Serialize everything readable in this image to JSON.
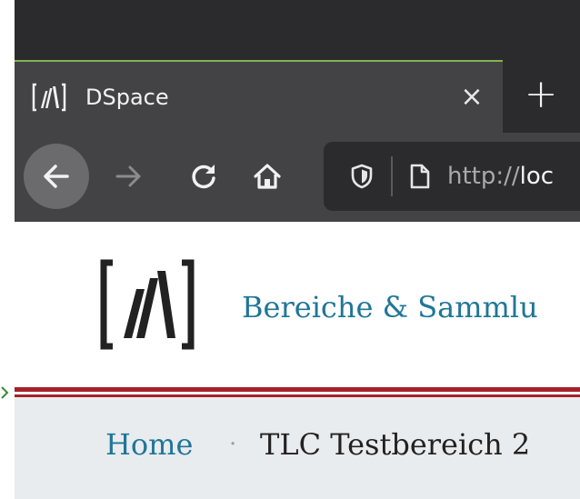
{
  "browser": {
    "tab": {
      "title": "DSpace",
      "close_glyph": "×",
      "favicon": "dspace-logo-icon"
    },
    "new_tab_glyph": "+",
    "nav": {
      "back_icon": "arrow-left-icon",
      "forward_icon": "arrow-right-icon",
      "reload_icon": "reload-icon",
      "home_icon": "home-icon"
    },
    "urlbar": {
      "scheme": "http://",
      "host_visible": "loc",
      "shield_icon": "shield-icon",
      "page_icon": "page-icon"
    },
    "colors": {
      "tab_active_border": "#7fb552",
      "chrome_dark": "#2b2b2d",
      "chrome_mid": "#434345"
    }
  },
  "site": {
    "logo": "dspace-logo-icon",
    "nav_link": "Bereiche & Sammlu",
    "accent_color": "#207698",
    "rule_color": "#a4222a"
  },
  "breadcrumb": {
    "home": "Home",
    "separator": "·",
    "current": "TLC Testbereich 2"
  }
}
